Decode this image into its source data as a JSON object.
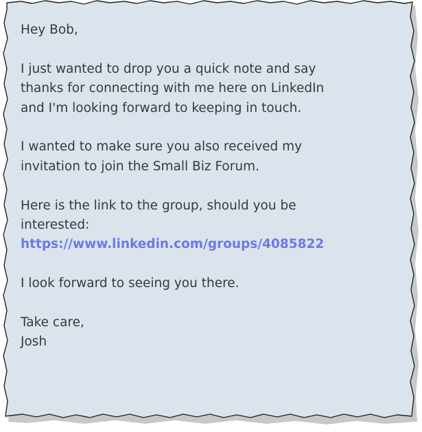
{
  "message": {
    "greeting": "Hey Bob,",
    "paragraph1": [
      "I just wanted to drop you a quick note and say",
      "thanks for connecting with me here on LinkedIn",
      "and I'm looking forward to keeping in touch."
    ],
    "paragraph2": [
      "I wanted to make sure you also received my",
      "invitation to join the Small Biz Forum."
    ],
    "paragraph3": [
      "Here is the link to the group, should you be",
      "interested:"
    ],
    "link": "https://www.linkedin.com/groups/4085822",
    "closing_line": "I look forward to seeing you there.",
    "signoff": "Take care,",
    "signature": "Josh"
  },
  "colors": {
    "background": "#dbe4ec",
    "text": "#333a40",
    "link": "#6e78e6",
    "border": "#222222",
    "shadow": "#9a9a9a"
  }
}
